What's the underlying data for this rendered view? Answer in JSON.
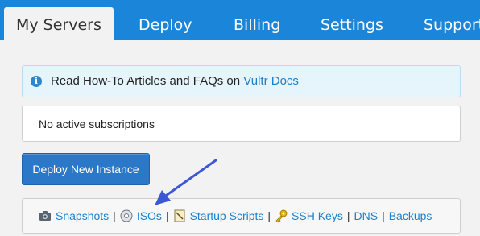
{
  "nav": {
    "tabs": [
      {
        "label": "My Servers"
      },
      {
        "label": "Deploy"
      },
      {
        "label": "Billing"
      },
      {
        "label": "Settings"
      },
      {
        "label": "Support"
      }
    ]
  },
  "info": {
    "text": "Read How-To Articles and FAQs on",
    "link": "Vultr Docs"
  },
  "subscriptions": {
    "empty_text": "No active subscriptions"
  },
  "deploy_button": {
    "label": "Deploy New Instance"
  },
  "links": {
    "separator": "|",
    "snapshots": "Snapshots",
    "isos": "ISOs",
    "startup_scripts": "Startup Scripts",
    "ssh_keys": "SSH Keys",
    "dns": "DNS",
    "backups": "Backups"
  },
  "colors": {
    "nav_bg": "#1b86d9",
    "link": "#1b7fcb",
    "button": "#2a78c7",
    "annotation_arrow": "#3a57d6"
  }
}
